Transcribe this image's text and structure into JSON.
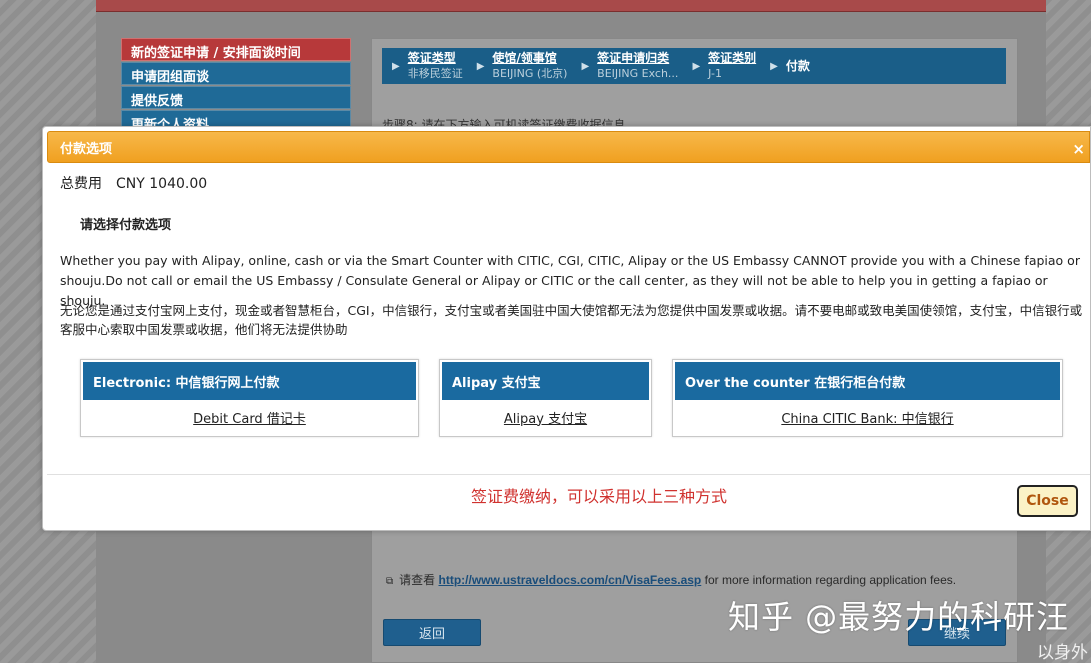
{
  "background": {
    "menu": [
      {
        "label": "新的签证申请 / 安排面谈时间",
        "active": true
      },
      {
        "label": "申请团组面谈",
        "active": false
      },
      {
        "label": "提供反馈",
        "active": false
      },
      {
        "label": "更新个人资料",
        "active": false
      }
    ],
    "breadcrumbs": [
      {
        "label": "签证类型",
        "value": "非移民签证"
      },
      {
        "label": "使馆/领事馆",
        "value": "BEIJING (北京)"
      },
      {
        "label": "签证申请归类",
        "value": "BEIJING Exch..."
      },
      {
        "label": "签证类别",
        "value": "J-1"
      },
      {
        "label": "付款",
        "value": ""
      }
    ],
    "step_text": "步骤8: 请在下方输入可机读签证缴费收据信息",
    "fee_note_prefix": "请查看",
    "fee_note_link": "http://www.ustraveldocs.com/cn/VisaFees.asp",
    "fee_note_suffix": "for more information regarding application fees.",
    "back_label": "返回",
    "continue_label": "继续",
    "watermark": "知乎 @最努力的科研汪",
    "watermark_small": "以身外"
  },
  "modal": {
    "title": "付款选项",
    "close_x": "×",
    "total_label": "总费用",
    "total_amount": "CNY 1040.00",
    "choose_label": "请选择付款选项",
    "note_en": "Whether you pay with Alipay, online, cash or via the Smart Counter with CITIC, CGI, CITIC, Alipay or the US Embassy CANNOT provide you with a Chinese fapiao or shouju.Do not call or email the US Embassy / Consulate General or Alipay or CITIC or the call center, as they will not be able to help you in getting a fapiao or shouju.",
    "note_zh": "无论您是通过支付宝网上支付，现金或者智慧柜台，CGI，中信银行，支付宝或者美国驻中国大使馆都无法为您提供中国发票或收据。请不要电邮或致电美国使领馆，支付宝，中信银行或客服中心索取中国发票或收据，他们将无法提供协助",
    "options": [
      {
        "header": "Electronic: 中信银行网上付款",
        "link": "Debit Card 借记卡"
      },
      {
        "header": "Alipay 支付宝",
        "link": "Alipay 支付宝"
      },
      {
        "header": "Over the counter 在银行柜台付款",
        "link": "China CITIC Bank: 中信银行"
      }
    ],
    "red_note": "签证费缴纳，可以采用以上三种方式",
    "close_label": "Close"
  },
  "colors": {
    "header_orange": "#f0a020",
    "option_blue": "#1a6aa0",
    "red_note": "#d0322f",
    "close_text": "#b0560e"
  }
}
